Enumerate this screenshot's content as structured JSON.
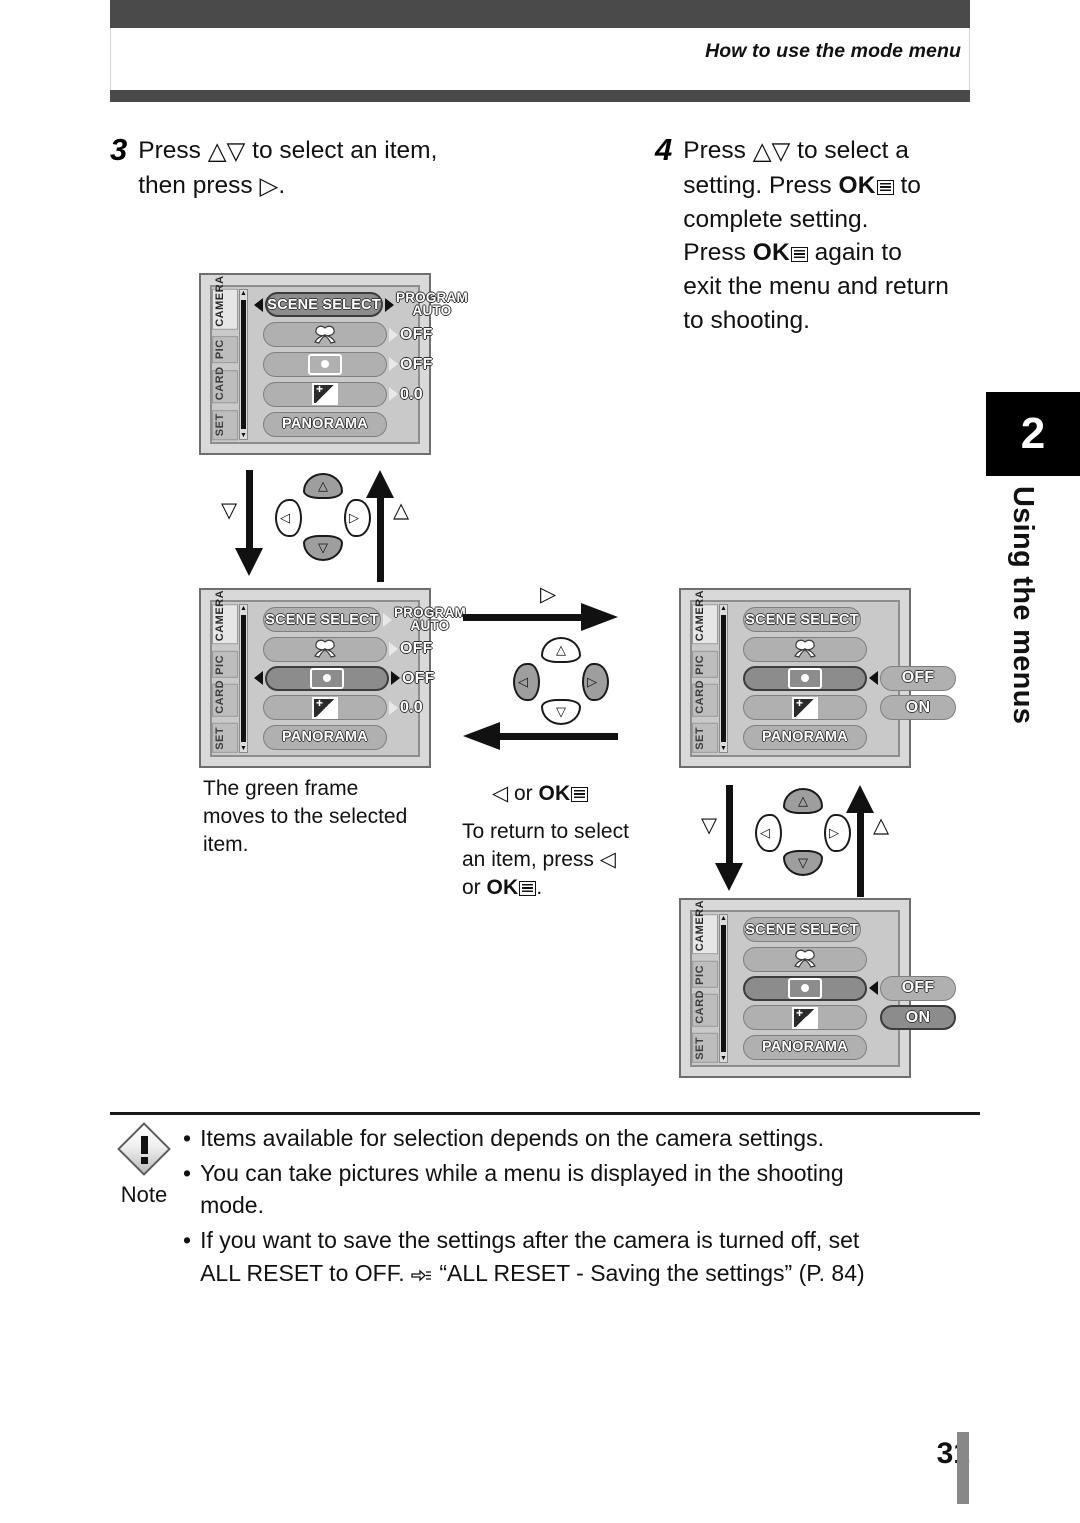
{
  "header": {
    "title": "How to use the mode menu"
  },
  "chapter": {
    "number": "2",
    "label": "Using the menus"
  },
  "steps": [
    {
      "number": "3",
      "text_parts": [
        "Press ",
        "△▽",
        " to select an item, then press ",
        "▷",
        "."
      ],
      "line1_pre": "Press ",
      "line1_post": " to select an item,",
      "line2_pre": "then press ",
      "line2_post": "."
    },
    {
      "number": "4",
      "l1a": "Press ",
      "l1b": " to select a",
      "l2a": "setting. Press ",
      "l2ok": "OK",
      "l2b": " to",
      "l3": "complete setting.",
      "l4a": "Press ",
      "l4ok": "OK",
      "l4b": " again to",
      "l5": "exit the menu and return",
      "l6": "to shooting."
    }
  ],
  "lcd_screens": [
    {
      "id": "screen-1",
      "tabs": [
        "CAMERA",
        "PIC",
        "CARD",
        "SET"
      ],
      "active_tab": "CAMERA",
      "rows": [
        {
          "label": "SCENE SELECT",
          "icon": "",
          "selected": true,
          "left_cursor": true,
          "right_cursor": "dark",
          "value": "PROGRAM AUTO",
          "value_small": true
        },
        {
          "label": "",
          "icon": "macro-icon",
          "selected": false,
          "left_cursor": false,
          "right_cursor": "light",
          "value": "OFF",
          "value_small": false
        },
        {
          "label": "",
          "icon": "spot-metering-icon",
          "selected": false,
          "left_cursor": false,
          "right_cursor": "light",
          "value": "OFF",
          "value_small": false
        },
        {
          "label": "",
          "icon": "exposure-compensation-icon",
          "selected": false,
          "left_cursor": false,
          "right_cursor": "light",
          "value": "0.0",
          "value_small": false
        },
        {
          "label": "PANORAMA",
          "icon": "",
          "selected": false,
          "left_cursor": false,
          "right_cursor": "none",
          "value": "",
          "value_small": false
        }
      ]
    },
    {
      "id": "screen-2",
      "tabs": [
        "CAMERA",
        "PIC",
        "CARD",
        "SET"
      ],
      "active_tab": "CAMERA",
      "rows": [
        {
          "label": "SCENE SELECT",
          "icon": "",
          "selected": false,
          "left_cursor": false,
          "right_cursor": "light",
          "value": "PROGRAM AUTO",
          "value_small": true
        },
        {
          "label": "",
          "icon": "macro-icon",
          "selected": false,
          "left_cursor": false,
          "right_cursor": "light",
          "value": "OFF",
          "value_small": false
        },
        {
          "label": "",
          "icon": "spot-metering-icon",
          "selected": true,
          "left_cursor": true,
          "right_cursor": "dark",
          "value": "OFF",
          "value_small": false
        },
        {
          "label": "",
          "icon": "exposure-compensation-icon",
          "selected": false,
          "left_cursor": false,
          "right_cursor": "light",
          "value": "0.0",
          "value_small": false
        },
        {
          "label": "PANORAMA",
          "icon": "",
          "selected": false,
          "left_cursor": false,
          "right_cursor": "none",
          "value": "",
          "value_small": false
        }
      ]
    },
    {
      "id": "screen-3",
      "tabs": [
        "CAMERA",
        "PIC",
        "CARD",
        "SET"
      ],
      "active_tab": "CAMERA",
      "rows": [
        {
          "label": "SCENE SELECT",
          "icon": "",
          "selected": false,
          "left_cursor": false,
          "right_cursor": "none",
          "value": "",
          "value_small": false
        },
        {
          "label": "",
          "icon": "macro-icon",
          "selected": false,
          "left_cursor": false,
          "right_cursor": "none",
          "value": "",
          "value_small": false
        },
        {
          "label": "",
          "icon": "spot-metering-icon",
          "selected": true,
          "left_cursor": false,
          "right_cursor": "none",
          "value": "OFF",
          "value_pill": true,
          "value_selected": false,
          "value_cursor_left": true
        },
        {
          "label": "",
          "icon": "exposure-compensation-icon",
          "selected": false,
          "left_cursor": false,
          "right_cursor": "none",
          "value": "ON",
          "value_pill": true,
          "value_selected": false
        },
        {
          "label": "PANORAMA",
          "icon": "",
          "selected": false,
          "left_cursor": false,
          "right_cursor": "none",
          "value": "",
          "value_small": false
        }
      ]
    },
    {
      "id": "screen-4",
      "tabs": [
        "CAMERA",
        "PIC",
        "CARD",
        "SET"
      ],
      "active_tab": "CAMERA",
      "rows": [
        {
          "label": "SCENE SELECT",
          "icon": "",
          "selected": false,
          "left_cursor": false,
          "right_cursor": "none",
          "value": "",
          "value_small": false
        },
        {
          "label": "",
          "icon": "macro-icon",
          "selected": false,
          "left_cursor": false,
          "right_cursor": "none",
          "value": "",
          "value_small": false
        },
        {
          "label": "",
          "icon": "spot-metering-icon",
          "selected": true,
          "left_cursor": false,
          "right_cursor": "none",
          "value": "OFF",
          "value_pill": true,
          "value_selected": false,
          "value_cursor_left": true
        },
        {
          "label": "",
          "icon": "exposure-compensation-icon",
          "selected": false,
          "left_cursor": false,
          "right_cursor": "none",
          "value": "ON",
          "value_pill": true,
          "value_selected": true
        },
        {
          "label": "PANORAMA",
          "icon": "",
          "selected": false,
          "left_cursor": false,
          "right_cursor": "none",
          "value": "",
          "value_small": false
        }
      ]
    }
  ],
  "labels": {
    "tri_down": "▽",
    "tri_up": "△",
    "tri_right": "▷",
    "tri_left": "◁"
  },
  "captions": {
    "green_frame": "The green frame moves to the selected item.",
    "green_frame_l1": "The green frame",
    "green_frame_l2": "moves to the selected",
    "green_frame_l3": "item.",
    "return_head_pre": "◁ or ",
    "return_head_ok": "OK",
    "return_l1": "To return to select",
    "return_l2a": "an item, press ",
    "return_l2b": "◁",
    "return_l3a": "or ",
    "return_l3ok": "OK",
    "return_l3b": "."
  },
  "note": {
    "label": "Note",
    "items": [
      "Items available for selection depends on the camera settings.",
      "You can take pictures while a menu is displayed in the shooting mode.",
      "If you want to save the settings after the camera is turned off, set ALL RESET to OFF."
    ],
    "item1": "Items available for selection depends on the camera settings.",
    "item2_l1": "You can take pictures while a menu is displayed in the shooting",
    "item2_l2": "mode.",
    "item3_l1": "If you want to save the settings after the camera is turned off, set",
    "item3_l2a": "ALL RESET to OFF.",
    "item3_l2b": "“ALL RESET - Saving the settings” (P. 84)"
  },
  "footer": {
    "page_number": "31"
  },
  "colors": {
    "header_band": "#4a4a4a",
    "chapter_bg": "#000000",
    "lcd_bg": "#c9c9c9",
    "lcd_frame": "#6e6e6e",
    "pill": "#b0b0b0",
    "pill_selected": "#8c8c8c"
  }
}
